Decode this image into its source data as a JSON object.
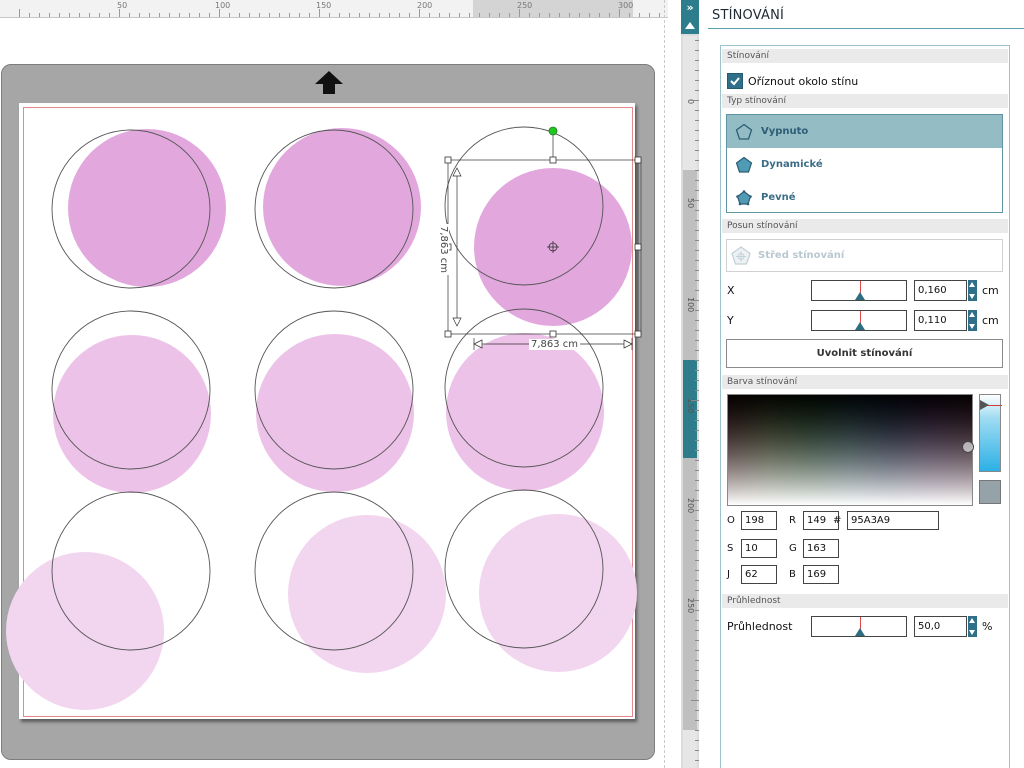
{
  "ruler": {
    "top_labels": [
      "50",
      "100",
      "150",
      "200",
      "250",
      "300"
    ],
    "side_labels": [
      "0",
      "50",
      "100",
      "150",
      "200",
      "250"
    ]
  },
  "canvas": {
    "dimension_vertical": "7,863 cm",
    "dimension_horizontal": "7,863 cm",
    "shadow_color": "#95A3A9",
    "fill_strong": "#e2a8de",
    "fill_light": "#edc2e8",
    "fill_pale": "#f2d5ef"
  },
  "panel": {
    "title": "STÍNOVÁNÍ",
    "section_shading": "Stínování",
    "clip_checkbox_label": "Oříznout okolo stínu",
    "clip_checked": true,
    "section_type": "Typ stínování",
    "types": [
      {
        "label": "Vypnuto",
        "icon": "pentagon-outline-icon",
        "selected": true
      },
      {
        "label": "Dynamické",
        "icon": "pentagon-filled-icon",
        "selected": false
      },
      {
        "label": "Pevné",
        "icon": "pentagon-points-icon",
        "selected": false
      }
    ],
    "section_offset": "Posun stínování",
    "center_button": "Střed stínování",
    "x_label": "X",
    "x_value": "0,160",
    "x_unit": "cm",
    "y_label": "Y",
    "y_value": "0,110",
    "y_unit": "cm",
    "release_button": "Uvolnit stínování",
    "section_color": "Barva stínování",
    "color": {
      "o_label": "O",
      "o_value": "198",
      "s_label": "S",
      "s_value": "10",
      "j_label": "J",
      "j_value": "62",
      "r_label": "R",
      "r_value": "149",
      "g_label": "G",
      "g_value": "163",
      "b_label": "B",
      "b_value": "169",
      "hex_label": "#",
      "hex_value": "95A3A9"
    },
    "section_opacity": "Průhlednost",
    "opacity_label": "Průhlednost",
    "opacity_value": "50,0",
    "opacity_unit": "%"
  }
}
